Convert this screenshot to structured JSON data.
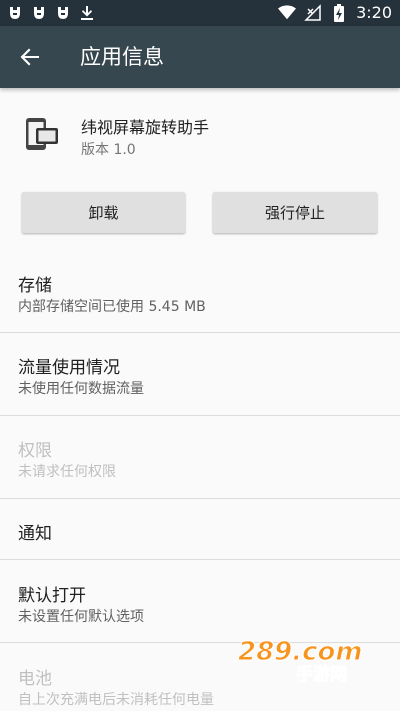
{
  "status_bar": {
    "time": "3:20",
    "left_icons": [
      "bug-icon",
      "bug-icon",
      "bug-icon",
      "download-icon"
    ],
    "right_icons": [
      "wifi-icon",
      "no-signal-icon",
      "battery-charging-icon"
    ]
  },
  "app_bar": {
    "title": "应用信息",
    "background": "#37474f",
    "status_bar_background": "#26323b"
  },
  "app": {
    "name": "纬视屏幕旋转助手",
    "version": "版本 1.0"
  },
  "buttons": {
    "uninstall": "卸载",
    "force_stop": "强行停止"
  },
  "sections": [
    {
      "title": "存储",
      "summary": "内部存储空间已使用 5.45 MB",
      "enabled": true
    },
    {
      "title": "流量使用情况",
      "summary": "未使用任何数据流量",
      "enabled": true
    },
    {
      "title": "权限",
      "summary": "未请求任何权限",
      "enabled": false
    },
    {
      "title": "通知",
      "summary": "",
      "enabled": true
    },
    {
      "title": "默认打开",
      "summary": "未设置任何默认选项",
      "enabled": true
    },
    {
      "title": "电池",
      "summary": "自上次充满电后未消耗任何电量",
      "enabled": false
    }
  ],
  "watermark": {
    "top": "289.com",
    "bottom": "手游网"
  }
}
